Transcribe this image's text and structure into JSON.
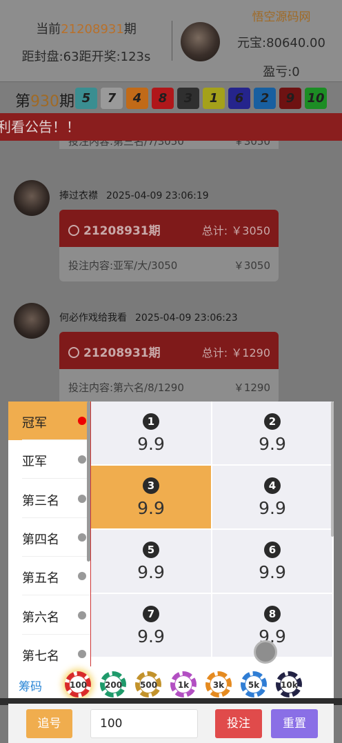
{
  "header": {
    "current_label_prefix": "当前",
    "current_period": "21208931",
    "current_label_suffix": "期",
    "countdown": "距封盘:63距开奖:123s",
    "site_name": "悟空源码网",
    "balance": "元宝:80640.00",
    "profit": "盈亏:0"
  },
  "draw": {
    "prefix": "第",
    "period": "930",
    "suffix": "期",
    "balls": [
      {
        "n": "5",
        "color": "#3a8e91"
      },
      {
        "n": "7",
        "color": "#9a9a9a"
      },
      {
        "n": "4",
        "color": "#c16a18"
      },
      {
        "n": "8",
        "color": "#b0171a"
      },
      {
        "n": "3",
        "color": "#2f2f2f"
      },
      {
        "n": "1",
        "color": "#a4a11a"
      },
      {
        "n": "6",
        "color": "#25248c"
      },
      {
        "n": "2",
        "color": "#185fa0"
      },
      {
        "n": "9",
        "color": "#6e1212"
      },
      {
        "n": "10",
        "color": "#1c8d24"
      }
    ]
  },
  "notice": "利看公告！！",
  "feed": {
    "cut_card": {
      "text": "投注内容:第三名/7/3050",
      "amount": "￥3050"
    },
    "posts": [
      {
        "name": "捧过衣襟",
        "date": "2025-04-09 23:06:19",
        "period": "21208931期",
        "total": "总计: ￥3050",
        "content": "投注内容:亚军/大/3050",
        "amount": "￥3050"
      },
      {
        "name": "何必作戏给我看",
        "date": "2025-04-09 23:06:23",
        "period": "21208931期",
        "total": "总计: ￥1290",
        "content": "投注内容:第六名/8/1290",
        "amount": "￥1290"
      }
    ]
  },
  "categories": [
    "冠军",
    "亚军",
    "第三名",
    "第四名",
    "第五名",
    "第六名",
    "第七名"
  ],
  "active_category": "冠军",
  "options": [
    {
      "n": "1",
      "odds": "9.9"
    },
    {
      "n": "2",
      "odds": "9.9"
    },
    {
      "n": "3",
      "odds": "9.9",
      "selected": true
    },
    {
      "n": "4",
      "odds": "9.9"
    },
    {
      "n": "5",
      "odds": "9.9"
    },
    {
      "n": "6",
      "odds": "9.9"
    },
    {
      "n": "7",
      "odds": "9.9"
    },
    {
      "n": "8",
      "odds": "9.9"
    }
  ],
  "chips": {
    "label": "筹码",
    "items": [
      {
        "v": "100",
        "color": "#d92a2a",
        "selected": true
      },
      {
        "v": "200",
        "color": "#1e9a6a"
      },
      {
        "v": "500",
        "color": "#c2922b"
      },
      {
        "v": "1k",
        "color": "#b24fc2"
      },
      {
        "v": "3k",
        "color": "#e58a1f"
      },
      {
        "v": "5k",
        "color": "#2f7dd4"
      },
      {
        "v": "10k",
        "color": "#222244"
      }
    ]
  },
  "bottom": {
    "follow": "追号",
    "amount": "100",
    "bet": "投注",
    "reset": "重置"
  }
}
